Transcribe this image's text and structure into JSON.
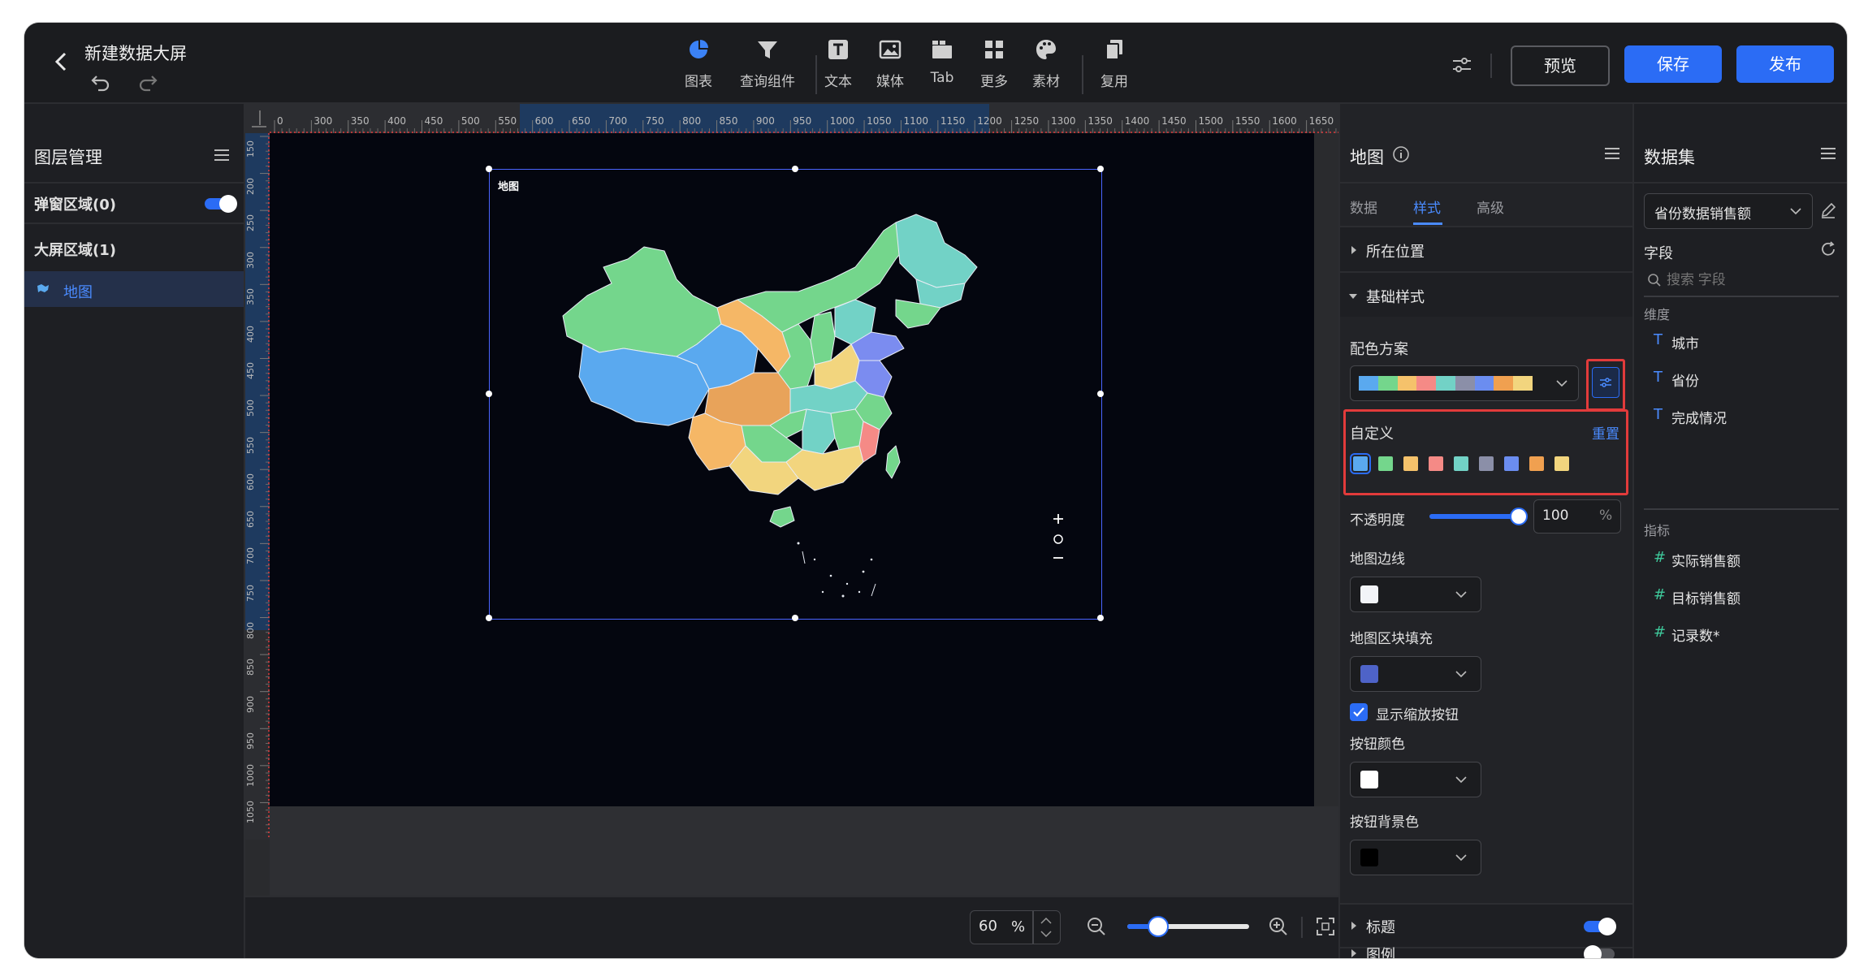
{
  "header": {
    "title": "新建数据大屏",
    "tools": [
      {
        "label": "图表",
        "icon": "pie-chart-icon"
      },
      {
        "label": "查询组件",
        "icon": "filter-icon"
      },
      {
        "label": "文本",
        "icon": "text-icon"
      },
      {
        "label": "媒体",
        "icon": "image-icon"
      },
      {
        "label": "Tab",
        "icon": "tab-icon"
      },
      {
        "label": "更多",
        "icon": "grid-icon"
      },
      {
        "label": "素材",
        "icon": "palette-icon"
      },
      {
        "label": "复用",
        "icon": "copy-icon"
      }
    ],
    "preview_label": "预览",
    "save_label": "保存",
    "publish_label": "发布"
  },
  "layers": {
    "title": "图层管理",
    "popup_section": "弹窗区域(0)",
    "screen_section": "大屏区域(1)",
    "items": [
      {
        "label": "地图"
      }
    ]
  },
  "canvas": {
    "ruler_h": [
      "0",
      "300",
      "350",
      "400",
      "450",
      "500",
      "550",
      "600",
      "650",
      "700",
      "750",
      "800",
      "850",
      "900",
      "950",
      "1000",
      "1050",
      "1100",
      "1150",
      "1200",
      "1250",
      "1300",
      "1350",
      "1400",
      "1450",
      "1500",
      "1550",
      "1600",
      "1650"
    ],
    "ruler_v": [
      "150",
      "200",
      "250",
      "300",
      "350",
      "400",
      "450",
      "500",
      "550",
      "600",
      "650",
      "700",
      "750",
      "800",
      "850",
      "900",
      "950",
      "1000",
      "1050"
    ],
    "component_label": "地图",
    "zoom_value": "60",
    "zoom_unit": "%",
    "zoom_level": 0.25,
    "map_colors": {
      "green": "#74d68c",
      "teal": "#72d2c6",
      "blue": "#5aa9ef",
      "orange": "#f5b766",
      "deeporange": "#e8a35a",
      "yellow": "#f2d57e",
      "pink": "#f58a86",
      "indigo": "#7b8cf0",
      "cyan": "#5cc4d8"
    }
  },
  "style_panel": {
    "title": "地图",
    "tabs": [
      "数据",
      "样式",
      "高级"
    ],
    "active_tab": "样式",
    "section_position": "所在位置",
    "section_basic": "基础样式",
    "color_scheme_label": "配色方案",
    "custom_label": "自定义",
    "reset_label": "重置",
    "palette": [
      "#5aa9ef",
      "#74d68c",
      "#f5c26b",
      "#f58a86",
      "#72d2c6",
      "#8b8fa8",
      "#6b8df0",
      "#f0a050",
      "#f2d57e"
    ],
    "opacity_label": "不透明度",
    "opacity_value": "100",
    "opacity_unit": "%",
    "opacity_level": 1.0,
    "border_label": "地图边线",
    "border_color": "#f2f4f8",
    "fill_label": "地图区块填充",
    "fill_color": "#4e63c8",
    "show_zoom_label": "显示缩放按钮",
    "btn_color_label": "按钮颜色",
    "btn_color": "#ffffff",
    "btn_bg_label": "按钮背景色",
    "btn_bg_color": "#000000",
    "title_section": "标题",
    "legend_section": "图例"
  },
  "dataset_panel": {
    "title": "数据集",
    "dataset_name": "省份数据销售额",
    "fields_label": "字段",
    "search_placeholder": "搜索 字段",
    "dimension_label": "维度",
    "dimensions": [
      "城市",
      "省份",
      "完成情况"
    ],
    "measure_label": "指标",
    "measures": [
      "实际销售额",
      "目标销售额",
      "记录数*"
    ]
  }
}
